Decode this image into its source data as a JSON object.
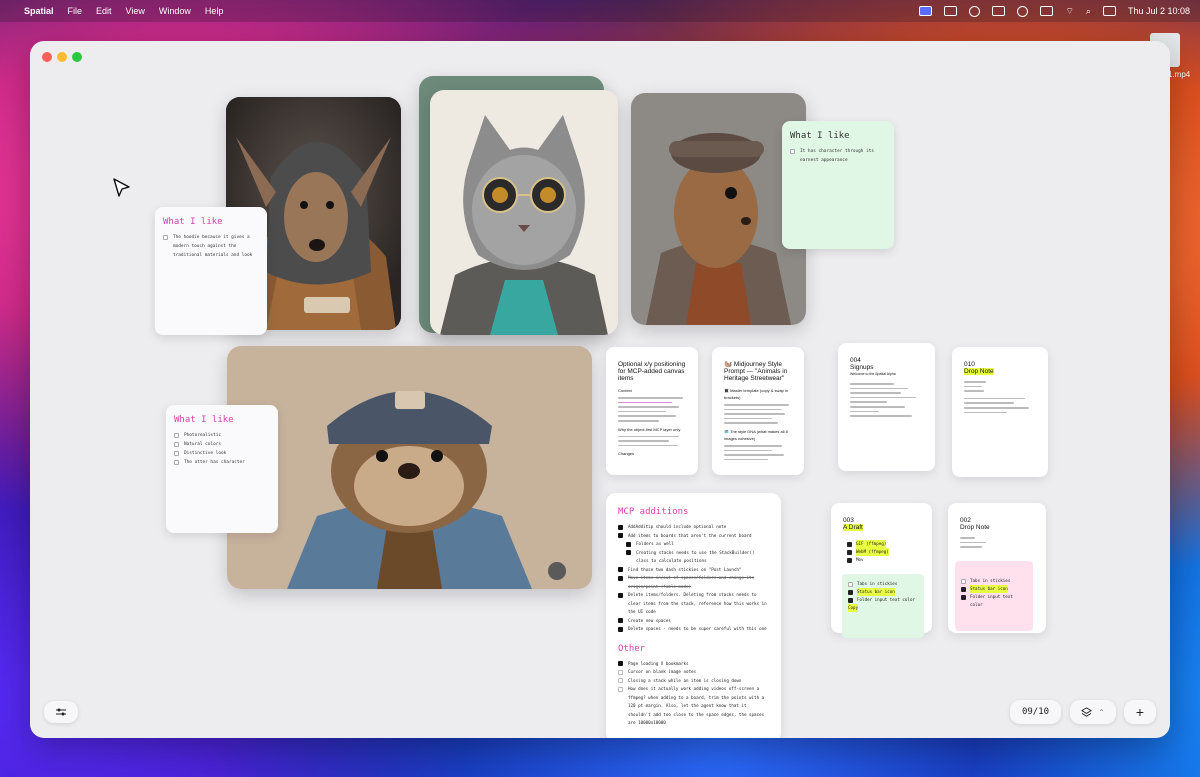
{
  "menubar": {
    "app": "Spatial",
    "menus": [
      "File",
      "Edit",
      "View",
      "Window",
      "Help"
    ],
    "clock": "Thu Jul 2  10:08"
  },
  "desktop": {
    "file_label": "1.mp4"
  },
  "notes": {
    "deer": {
      "title": "What I like",
      "items": [
        "The hoodie because it gives a modern touch against the traditional materials and look"
      ]
    },
    "squirrel": {
      "title": "What I like",
      "items": [
        "It has character through its earnest appearance"
      ]
    },
    "otter": {
      "title": "What I like",
      "items": [
        "Photorealistic",
        "Natural colors",
        "Distinctive look",
        "The otter has character"
      ]
    }
  },
  "docs": {
    "doc1": {
      "title": "Optional x/y positioning for MCP-added canvas items",
      "sub": "Context",
      "sub2": "Why the object-first MCP layer only",
      "sub3": "Changes"
    },
    "doc2": {
      "title": "🐿️ Midjourney Style Prompt — \"Animals in Heritage Streetwear\"",
      "sub": "🔳 Master template (copy & swap in brackets)",
      "sub2": "🗺️ The style DNA (what makes all 8 images cohesive)"
    },
    "doc3": {
      "num": "004",
      "title": "Signups",
      "sub": "Welcome to the Spatial Alpha"
    },
    "doc4": {
      "num": "010",
      "title": "Drop Note"
    },
    "doc5": {
      "num": "003",
      "title": "A Draft",
      "items": [
        "GIF (ffmpeg)",
        "WebM (ffmpeg)",
        "Mov"
      ],
      "sub_items": [
        "Tabs in stickies",
        "Status bar icon",
        "Folder input text color",
        "Copy"
      ]
    },
    "doc6": {
      "num": "002",
      "title": "Drop Note",
      "sub_items": [
        "Tabs in stickies",
        "Status bar icon",
        "Folder input text color"
      ]
    }
  },
  "mcp": {
    "title": "MCP additions",
    "items": [
      {
        "text": "AddAdditip should include optional note",
        "level": 0,
        "state": "done"
      },
      {
        "text": "Add items to boards that aren't the current board",
        "level": 0,
        "state": "done"
      },
      {
        "text": "Folders as well",
        "level": 1,
        "state": "done"
      },
      {
        "text": "Creating stacks needs to use the StackBuilder() class to calculate positions",
        "level": 1,
        "state": "done"
      },
      {
        "text": "Find those two dash stickies on \"Post Launch\"",
        "level": 0,
        "state": "done"
      },
      {
        "text": "Move items in/out of spaces/folders and change its origin/point (fable mode)",
        "level": 0,
        "state": "strike"
      },
      {
        "text": "Delete items/folders. Deleting from stacks needs to clear items from the stack, reference how this works in the UI code",
        "level": 0,
        "state": "done"
      },
      {
        "text": "Create new spaces",
        "level": 0,
        "state": "done"
      },
      {
        "text": "Delete spaces - needs to be super careful with this one",
        "level": 0,
        "state": "done"
      }
    ],
    "other_title": "Other",
    "other_items": [
      {
        "text": "Page loading X bookmarks",
        "state": "done"
      },
      {
        "text": "Cursor on blank image notes",
        "state": "open"
      },
      {
        "text": "Closing a stack while an item is closing down",
        "state": "open"
      },
      {
        "text": "How does it actually work adding videos off-screen a ffmpeg? when adding to a board, trim the points with a 120 pt margin. Also, let the agent know that it shouldn't add too close to the space edges, the spaces are 10000x10000",
        "state": "open"
      }
    ]
  },
  "bottom": {
    "page": "09/10"
  },
  "colors": {
    "accent": "#d63fb0",
    "highlight": "#e9ff43",
    "green_note": "#dff7e4",
    "pink_note": "#ffe0ec"
  }
}
